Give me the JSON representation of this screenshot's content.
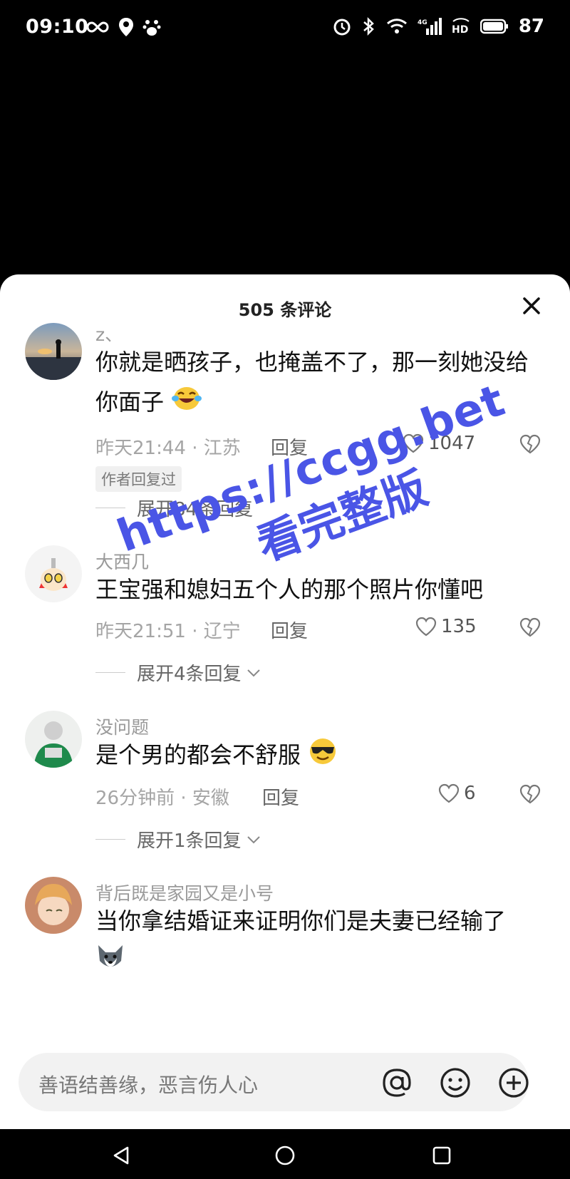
{
  "status_bar": {
    "time": "09:10",
    "battery": "87",
    "icons_left": [
      "infinity-icon",
      "location-pin-icon",
      "baidu-paw-icon"
    ],
    "icons_right": [
      "alarm-icon",
      "bluetooth-icon",
      "wifi-icon",
      "4g-signal-icon",
      "hd-icon",
      "battery-icon"
    ]
  },
  "sheet": {
    "title": "505 条评论"
  },
  "comments": [
    {
      "user": "z、",
      "text": "你就是晒孩子，也掩盖不了，那一刻她没给你面子",
      "emoji": "laughing-crying-emoji",
      "time_location": "昨天21:44 · 江苏",
      "reply_label": "回复",
      "likes": "1047",
      "badge": "作者回复过",
      "expand": "展开84条回复"
    },
    {
      "user": "大西几",
      "text": "王宝强和媳妇五个人的那个照片你懂吧",
      "time_location": "昨天21:51 · 辽宁",
      "reply_label": "回复",
      "likes": "135",
      "expand": "展开4条回复"
    },
    {
      "user": "没问题",
      "text": "是个男的都会不舒服",
      "emoji": "sunglasses-emoji",
      "time_location": "26分钟前 · 安徽",
      "reply_label": "回复",
      "likes": "6",
      "expand": "展开1条回复"
    },
    {
      "user": "背后既是家园又是小号",
      "text": "当你拿结婚证来证明你们是夫妻已经输了",
      "emoji": "husky-dog-emoji"
    }
  ],
  "watermark": {
    "line1": "https://ccgg.bet",
    "line2": "看完整版"
  },
  "input": {
    "placeholder": "善语结善缘，恶言伤人心"
  },
  "colors": {
    "watermark": "#4a55e6",
    "meta_gray": "#a5a5a5",
    "sheet_bg": "#ffffff",
    "input_bg": "#f2f2f2"
  }
}
